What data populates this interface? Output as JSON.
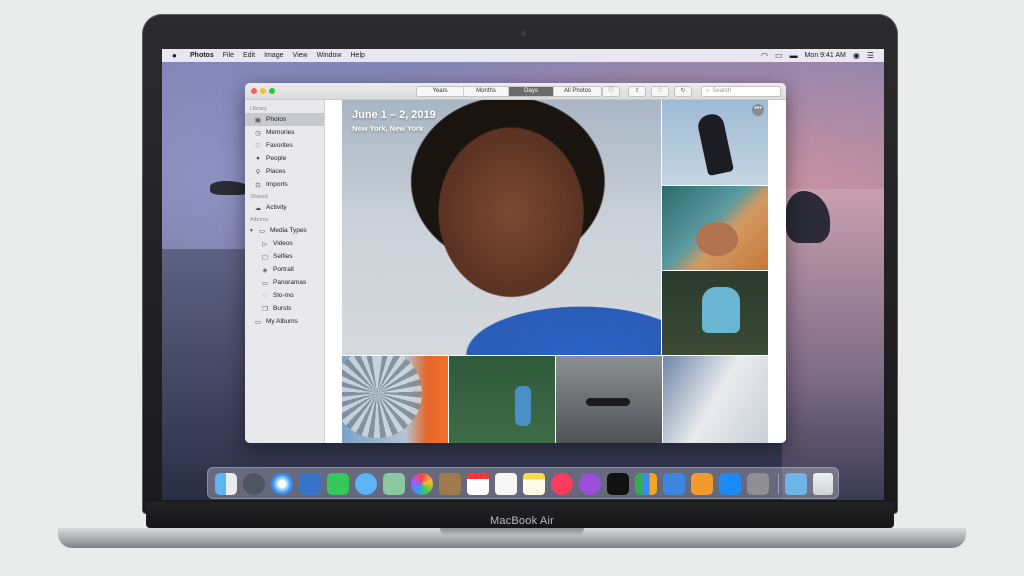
{
  "menubar": {
    "app_name": "Photos",
    "items": [
      "File",
      "Edit",
      "Image",
      "View",
      "Window",
      "Help"
    ],
    "clock": "Mon 9:41 AM"
  },
  "toolbar": {
    "views": [
      "Years",
      "Months",
      "Days",
      "All Photos"
    ],
    "active_view": "Days",
    "search_placeholder": "Search"
  },
  "sidebar": {
    "sections": [
      {
        "header": "Library",
        "items": [
          {
            "label": "Photos",
            "icon": "photos-icon",
            "active": true
          },
          {
            "label": "Memories",
            "icon": "memories-icon"
          },
          {
            "label": "Favorites",
            "icon": "heart-icon"
          },
          {
            "label": "People",
            "icon": "person-icon"
          },
          {
            "label": "Places",
            "icon": "pin-icon"
          },
          {
            "label": "Imports",
            "icon": "import-icon"
          }
        ]
      },
      {
        "header": "Shared",
        "items": [
          {
            "label": "Activity",
            "icon": "cloud-icon"
          }
        ]
      },
      {
        "header": "Albums",
        "items": [
          {
            "label": "Media Types",
            "icon": "folder-icon"
          },
          {
            "label": "Videos",
            "icon": "video-icon",
            "sub": true
          },
          {
            "label": "Selfies",
            "icon": "selfie-icon",
            "sub": true
          },
          {
            "label": "Portrait",
            "icon": "portrait-icon",
            "sub": true
          },
          {
            "label": "Panoramas",
            "icon": "panorama-icon",
            "sub": true
          },
          {
            "label": "Slo-mo",
            "icon": "slomo-icon",
            "sub": true
          },
          {
            "label": "Bursts",
            "icon": "burst-icon",
            "sub": true
          },
          {
            "label": "My Albums",
            "icon": "folder-icon"
          }
        ]
      }
    ]
  },
  "hero": {
    "date": "June 1 – 2, 2019",
    "place": "New York, New York"
  },
  "laptop": {
    "model": "MacBook Air"
  },
  "colors": {
    "accent_blue": "#2a5cb8",
    "sidebar_selected": "#c7c9ce"
  }
}
